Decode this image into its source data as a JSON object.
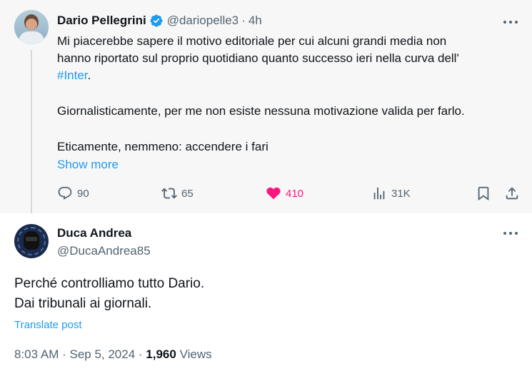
{
  "parent_tweet": {
    "author_name": "Dario Pellegrini",
    "handle": "@dariopelle3",
    "separator": "·",
    "time": "4h",
    "text_line1": "Mi piacerebbe sapere il motivo editoriale per cui alcuni grandi media non",
    "text_line2": "hanno riportato sul proprio quotidiano quanto successo ieri nella curva dell'",
    "hashtag": "#Inter",
    "text_after_hashtag": ".",
    "text_para2": "Giornalisticamente, per me non esiste nessuna motivazione valida per farlo.",
    "text_para3": "Eticamente, nemmeno: accendere i fari",
    "show_more": "Show more",
    "replies": "90",
    "retweets": "65",
    "likes": "410",
    "views": "31K"
  },
  "reply_tweet": {
    "author_name": "Duca Andrea",
    "handle": "@DucaAndrea85",
    "text_line1": "Perché controlliamo tutto Dario.",
    "text_line2": "Dai tribunali ai giornali.",
    "translate": "Translate post",
    "timestamp": "8:03 AM · Sep 5, 2024 ·",
    "views_count": "1,960",
    "views_label": "Views"
  },
  "colors": {
    "accent": "#1d9bf0",
    "like": "#f91880",
    "secondary_text": "#536471",
    "parent_bg": "#f7f7f7"
  }
}
